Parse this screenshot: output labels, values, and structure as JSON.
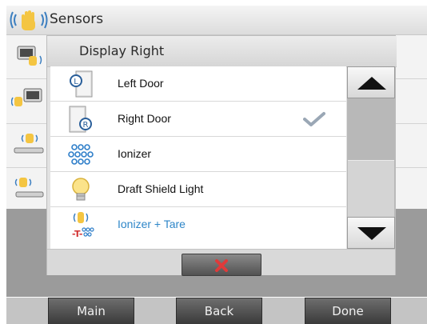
{
  "screen": {
    "title": "Sensors",
    "background_rows": [
      "row-1",
      "row-2",
      "row-3",
      "row-4"
    ]
  },
  "dialog": {
    "title": "Display Right",
    "items": [
      {
        "label": "Left Door",
        "icon": "left-door-icon",
        "selected": false,
        "highlighted": false
      },
      {
        "label": "Right Door",
        "icon": "right-door-icon",
        "selected": true,
        "highlighted": false
      },
      {
        "label": "Ionizer",
        "icon": "ionizer-icon",
        "selected": false,
        "highlighted": false
      },
      {
        "label": "Draft Shield Light",
        "icon": "light-bulb-icon",
        "selected": false,
        "highlighted": false
      },
      {
        "label": "Ionizer + Tare",
        "icon": "ionizer-tare-icon",
        "selected": false,
        "highlighted": true
      }
    ],
    "scroll_up_icon": "arrow-up-icon",
    "scroll_down_icon": "arrow-down-icon",
    "cancel_icon": "red-x-icon"
  },
  "nav": {
    "main": "Main",
    "back": "Back",
    "done": "Done"
  },
  "colors": {
    "highlight_text": "#2e86c8",
    "cancel_x": "#e03a3a",
    "check": "#9aa7b5",
    "nav_button": "#4a4a4a"
  }
}
